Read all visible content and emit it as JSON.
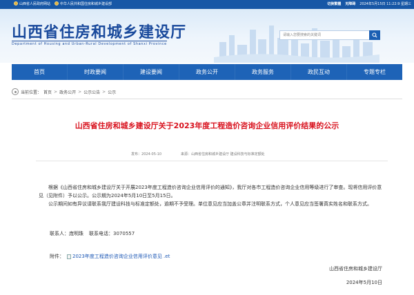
{
  "topbar": {
    "link1": "山西省人民政府网站",
    "link2": "中华人民共和国住房和城乡建设部",
    "switch": "切换繁體",
    "a11y": "无障碍",
    "datetime": "2024年5月15日 11:22:9 星期三"
  },
  "banner": {
    "title": "山西省住房和城乡建设厅",
    "subtitle": "Department of Housing and Urban-Rural Development of Shanxi Province",
    "search_placeholder": "请输入您要搜索的关键词"
  },
  "nav": [
    {
      "label": "首页"
    },
    {
      "label": "时政要闻"
    },
    {
      "label": "建设要闻"
    },
    {
      "label": "政务公开"
    },
    {
      "label": "政务服务"
    },
    {
      "label": "政民互动"
    },
    {
      "label": "专题专栏"
    }
  ],
  "breadcrumb": {
    "prefix": "当前位置：",
    "items": [
      "首页",
      "政务公开",
      "公示公告",
      "公示"
    ],
    "separator": ">"
  },
  "article": {
    "title": "山西省住房和城乡建设厅关于2023年度工程造价咨询企业信用评价结果的公示",
    "date_label": "发布：",
    "date": "2024-05-10",
    "source_label": "来源：",
    "source": "山西省住房和城乡建设厅 建设科技与标准定额处",
    "para1": "根据《山西省住房和城乡建设厅关于开展2023年度工程造价咨询企业信用评价的通知》，我厅对各市工程造价咨询企业信用等级进行了审查。现将信用评价意见（见附件）予以公示。公示期为2024年5月10日至5月15日。",
    "para2": "公示期间如有异议请联系我厅建设科技与标准定额处，逾期不予受理。单位意见应当加盖公章并注明联系方式，个人意见应当签署真实姓名和联系方式。",
    "contact_name": "联系人：庞明珠",
    "contact_phone": "联系电话：3070557",
    "attach_label": "附件：",
    "attach_link": "2023年度工程造价咨询企业信用评价意见 .et",
    "sign_org": "山西省住房和城乡建设厅",
    "sign_date": "2024年5月10日"
  },
  "colors": {
    "topbar": "#1757a6",
    "nav": "#1e63b7",
    "title": "#d8111d",
    "logo": "#1a4a9c"
  }
}
